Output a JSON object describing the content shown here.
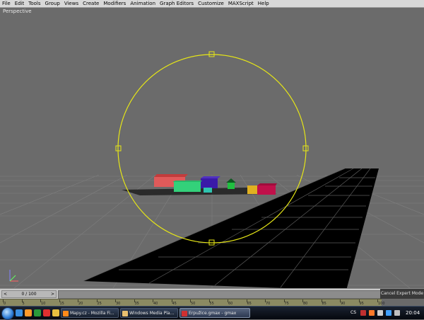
{
  "menu": [
    "File",
    "Edit",
    "Tools",
    "Group",
    "Views",
    "Create",
    "Modifiers",
    "Animation",
    "Graph Editors",
    "Customize",
    "MAXScript",
    "Help"
  ],
  "viewport": {
    "label": "Perspective"
  },
  "timeslider": {
    "position": "0 / 100",
    "prev_arrow": "<",
    "next_arrow": ">",
    "cancel_label": "Cancel Expert Mode"
  },
  "ruler": {
    "ticks": [
      "0",
      "5",
      "10",
      "15",
      "20",
      "25",
      "30",
      "35",
      "40",
      "45",
      "50",
      "55",
      "60",
      "65",
      "70",
      "75",
      "80",
      "85",
      "90",
      "95",
      "100"
    ]
  },
  "taskbar": {
    "windows": [
      {
        "label": "Mapy.cz - Mozilla Fi...",
        "icon": "firefox-icon",
        "active": false
      },
      {
        "label": "Windows Media Pla...",
        "icon": "folder-icon",
        "active": false
      },
      {
        "label": "Erpužice.gmax - gmax",
        "icon": "gmax-icon",
        "active": true
      }
    ],
    "language": "CS",
    "clock": "20:04"
  },
  "colors": {
    "gizmo": "#e6e617",
    "grid": "#c8c8c8",
    "road": "#000000",
    "viewport_bg": "#6b6b6b"
  },
  "buildings": [
    {
      "name": "red-building",
      "color": "#e05a5a"
    },
    {
      "name": "green-building",
      "color": "#33d17a"
    },
    {
      "name": "purple-building",
      "color": "#3a1aa8"
    },
    {
      "name": "yellow-building",
      "color": "#e0b020"
    },
    {
      "name": "magenta-building",
      "color": "#c0104a"
    },
    {
      "name": "small-green-house",
      "color": "#20c040"
    }
  ]
}
